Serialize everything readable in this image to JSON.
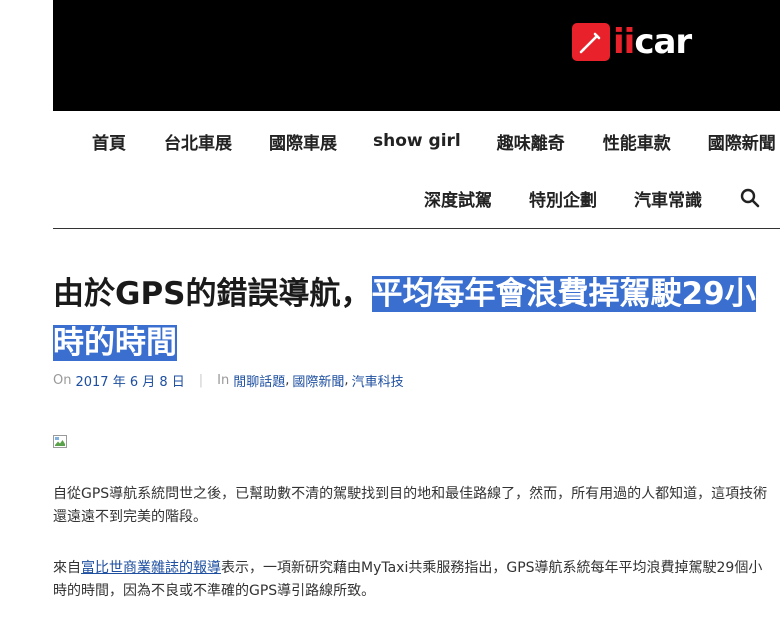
{
  "brand": {
    "logo_text_a": "i",
    "logo_text_b": "i",
    "logo_text_c": "car"
  },
  "nav": {
    "row1": [
      "首頁",
      "台北車展",
      "國際車展",
      "show girl",
      "趣味離奇",
      "性能車款",
      "國際新聞"
    ],
    "row2": [
      "深度試駕",
      "特別企劃",
      "汽車常識"
    ]
  },
  "article": {
    "title_plain": "由於GPS的錯誤導航，",
    "title_highlight_1": "平均每年會浪費掉駕駛29小",
    "title_highlight_2": "時的時間",
    "meta": {
      "on_label": "On",
      "date": "2017 年 6 月 8 日",
      "separator": "|",
      "in_label": "In",
      "categories": [
        "閒聊話題",
        "國際新聞",
        "汽車科技"
      ],
      "comma": ","
    },
    "p1": "自從GPS導航系統問世之後，已幫助數不清的駕駛找到目的地和最佳路線了，然而，所有用過的人都知道，這項技術還遠遠不到完美的階段。",
    "p2_before": "來自",
    "p2_link": "富比世商業雜誌的報導",
    "p2_after": "表示，一項新研究藉由MyTaxi共乘服務指出，GPS導航系統每年平均浪費掉駕駛29個小時的時間，因為不良或不準確的GPS導引路線所致。"
  },
  "colors": {
    "header_bg": "#000000",
    "brand_red": "#e8212a",
    "highlight": "#3a6fd0",
    "link": "#1e4fa0"
  },
  "icons": {
    "search": "search-icon",
    "logo": "pen-icon",
    "image": "broken-image-icon"
  }
}
